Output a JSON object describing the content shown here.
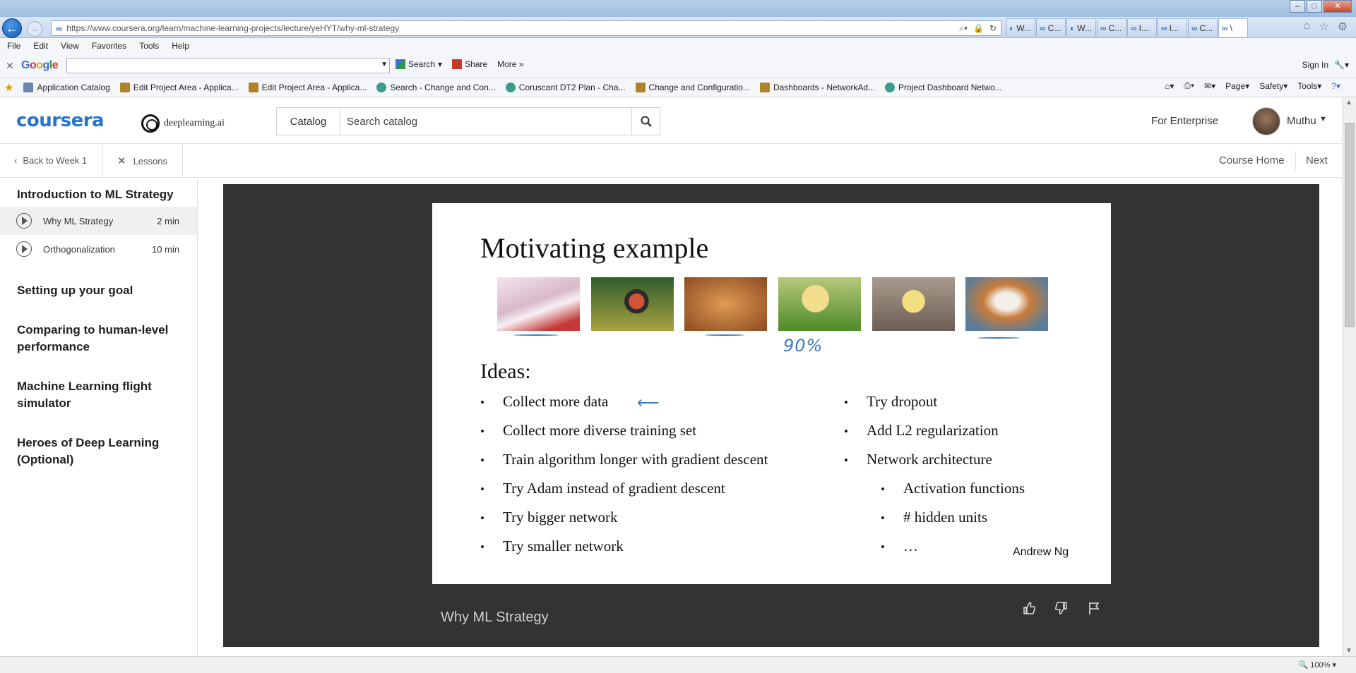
{
  "browser": {
    "url": "https://www.coursera.org/learn/machine-learning-projects/lecture/yeHYT/why-ml-strategy",
    "tabs": [
      "W...",
      "C...",
      "W...",
      "C...",
      "I...",
      "I...",
      "C...",
      "\\"
    ],
    "menu": [
      "File",
      "Edit",
      "View",
      "Favorites",
      "Tools",
      "Help"
    ],
    "google": {
      "logo": "Google",
      "search": "Search",
      "share": "Share",
      "more": "More »",
      "signin": "Sign In"
    },
    "favorites": [
      "Application Catalog",
      "Edit Project Area - Applica...",
      "Edit Project Area - Applica...",
      "Search - Change and Con...",
      "Coruscant DT2 Plan - Cha...",
      "Change and Configuratio...",
      "Dashboards - NetworkAd...",
      "Project Dashboard Netwo..."
    ],
    "commands": [
      "Page",
      "Safety",
      "Tools"
    ],
    "zoom": "100%"
  },
  "header": {
    "logo": "coursera",
    "partner": "deeplearning.ai",
    "catalog": "Catalog",
    "search_placeholder": "Search catalog",
    "enterprise": "For Enterprise",
    "user": "Muthu"
  },
  "subnav": {
    "back": "Back to Week 1",
    "lessons": "Lessons",
    "course_home": "Course Home",
    "next": "Next"
  },
  "sidebar": {
    "sections": [
      {
        "title": "Introduction to ML Strategy"
      },
      {
        "title": "Setting up your goal"
      },
      {
        "title": "Comparing to human-level performance"
      },
      {
        "title": "Machine Learning flight simulator"
      },
      {
        "title": "Heroes of Deep Learning (Optional)"
      }
    ],
    "lessons": [
      {
        "name": "Why ML Strategy",
        "duration": "2 min"
      },
      {
        "name": "Orthogonalization",
        "duration": "10 min"
      }
    ]
  },
  "slide": {
    "title": "Motivating example",
    "annotation": "90%",
    "ideas_heading": "Ideas:",
    "left_bullets": [
      "Collect more data",
      "Collect more diverse training set",
      "Train algorithm longer with gradient descent",
      "Try Adam instead of gradient descent",
      "Try bigger network",
      "Try smaller network"
    ],
    "right_bullets": [
      "Try dropout",
      "Add L2 regularization",
      "Network architecture"
    ],
    "sub_bullets": [
      "Activation functions",
      "# hidden units",
      "…"
    ],
    "author": "Andrew Ng"
  },
  "video": {
    "title": "Why ML Strategy"
  },
  "colors": {
    "accent": "#2a73cc",
    "video_bg": "#333333",
    "annotation": "#3c7cc0"
  }
}
